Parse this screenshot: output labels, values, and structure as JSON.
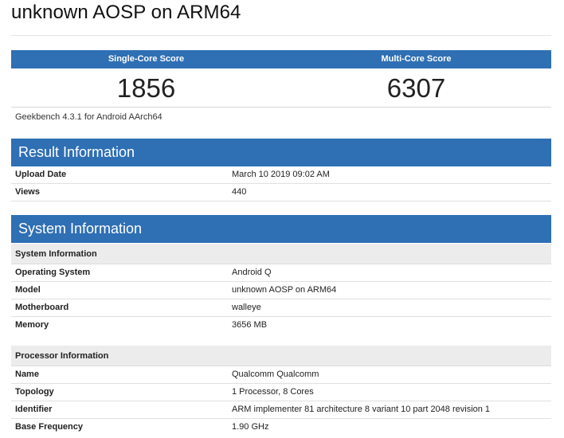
{
  "page": {
    "title": "unknown AOSP on ARM64"
  },
  "scores": {
    "single_core_label": "Single-Core Score",
    "multi_core_label": "Multi-Core Score",
    "single_core_value": "1856",
    "multi_core_value": "6307",
    "version": "Geekbench 4.3.1 for Android AArch64"
  },
  "result_info": {
    "title": "Result Information",
    "rows": [
      {
        "key": "Upload Date",
        "value": "March 10 2019 09:02 AM"
      },
      {
        "key": "Views",
        "value": "440"
      }
    ]
  },
  "system_info": {
    "title": "System Information",
    "system_sub": "System Information",
    "system_rows": [
      {
        "key": "Operating System",
        "value": "Android Q"
      },
      {
        "key": "Model",
        "value": "unknown AOSP on ARM64"
      },
      {
        "key": "Motherboard",
        "value": "walleye"
      },
      {
        "key": "Memory",
        "value": "3656 MB"
      }
    ],
    "processor_sub": "Processor Information",
    "processor_rows": [
      {
        "key": "Name",
        "value": "Qualcomm Qualcomm"
      },
      {
        "key": "Topology",
        "value": "1 Processor, 8 Cores"
      },
      {
        "key": "Identifier",
        "value": "ARM implementer 81 architecture 8 variant 10 part 2048 revision 1"
      },
      {
        "key": "Base Frequency",
        "value": "1.90 GHz"
      }
    ]
  },
  "colors": {
    "accent": "#2f6fb4",
    "subhead_bg": "#ececec"
  }
}
